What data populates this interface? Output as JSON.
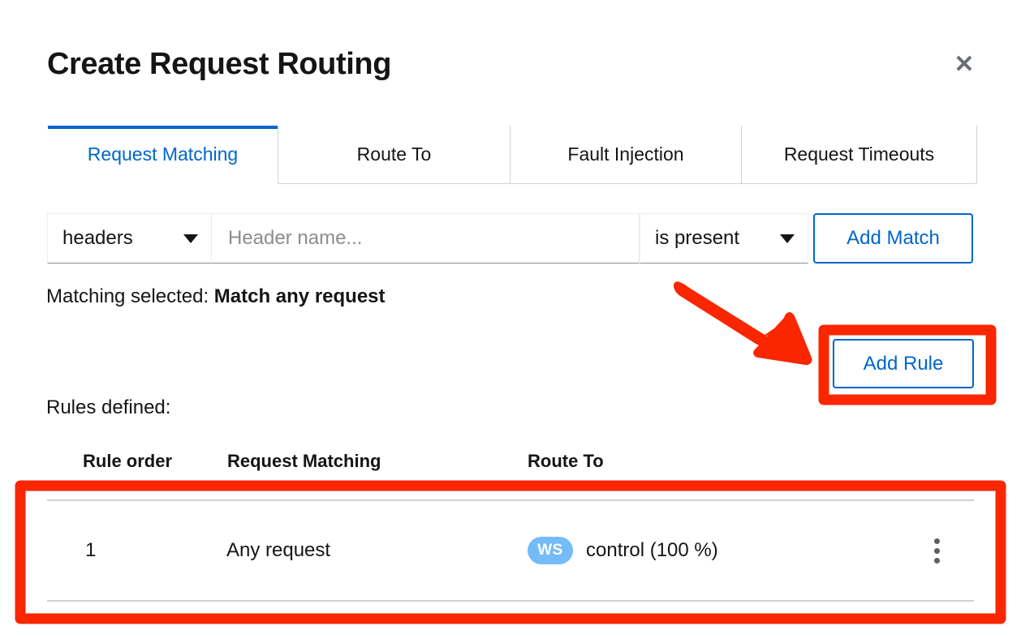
{
  "modal": {
    "title": "Create Request Routing",
    "close_label": "✕"
  },
  "tabs": [
    {
      "label": "Request Matching",
      "active": true
    },
    {
      "label": "Route To",
      "active": false
    },
    {
      "label": "Fault Injection",
      "active": false
    },
    {
      "label": "Request Timeouts",
      "active": false
    }
  ],
  "match_form": {
    "type_select_value": "headers",
    "header_input_value": "",
    "header_input_placeholder": "Header name...",
    "operator_select_value": "is present",
    "add_match_label": "Add Match"
  },
  "matching_selected": {
    "prefix": "Matching selected: ",
    "value": "Match any request"
  },
  "add_rule_label": "Add Rule",
  "rules_defined_label": "Rules defined:",
  "table": {
    "columns": [
      "Rule order",
      "Request Matching",
      "Route To"
    ],
    "rows": [
      {
        "order": "1",
        "request_matching": "Any request",
        "route_badge": "WS",
        "route_to": "control (100 %)"
      }
    ]
  },
  "colors": {
    "accent_blue": "#0066cc",
    "badge_blue": "#73bcf7",
    "annotation_red": "#fa2600",
    "text": "#151515",
    "border_gray": "#d2d2d2",
    "placeholder_gray": "#8a8d90"
  },
  "annotations": [
    {
      "kind": "arrow",
      "points_to": "add-rule-button"
    },
    {
      "kind": "rectangle",
      "surrounds": "add-rule-button"
    },
    {
      "kind": "rectangle",
      "surrounds": "rules-table-row-1"
    }
  ]
}
